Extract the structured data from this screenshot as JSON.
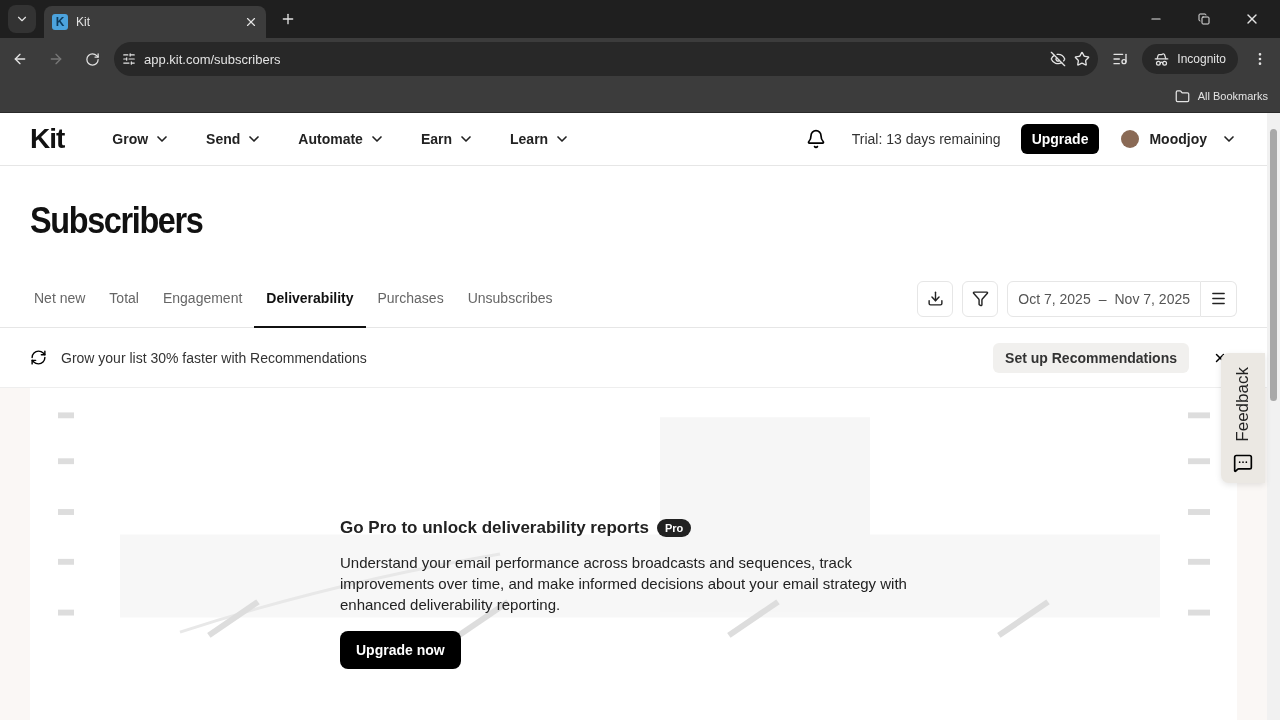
{
  "browser": {
    "favicon": "K",
    "tab_title": "Kit",
    "url": "app.kit.com/subscribers",
    "profile": "Incognito",
    "bookmarks": "All Bookmarks"
  },
  "nav": {
    "logo": "Kit",
    "items": [
      {
        "label": "Grow"
      },
      {
        "label": "Send"
      },
      {
        "label": "Automate"
      },
      {
        "label": "Earn"
      },
      {
        "label": "Learn"
      }
    ],
    "trial": "Trial: 13 days remaining",
    "upgrade": "Upgrade",
    "user": "Moodjoy"
  },
  "page_title": "Subscribers",
  "tabs": [
    {
      "label": "Net new",
      "selected": false
    },
    {
      "label": "Total",
      "selected": false
    },
    {
      "label": "Engagement",
      "selected": false
    },
    {
      "label": "Deliverability",
      "selected": true
    },
    {
      "label": "Purchases",
      "selected": false
    },
    {
      "label": "Unsubscribes",
      "selected": false
    }
  ],
  "date_range": {
    "start": "Oct 7, 2025",
    "separator": "–",
    "end": "Nov 7, 2025"
  },
  "banner": {
    "text": "Grow your list 30% faster with Recommendations",
    "button": "Set up Recommendations"
  },
  "promo": {
    "title": "Go Pro to unlock deliverability reports",
    "badge": "Pro",
    "body": "Understand your email performance across broadcasts and sequences, track improvements over time, and make informed decisions about your email strategy with enhanced deliverability reporting.",
    "button": "Upgrade now"
  },
  "feedback": "Feedback"
}
